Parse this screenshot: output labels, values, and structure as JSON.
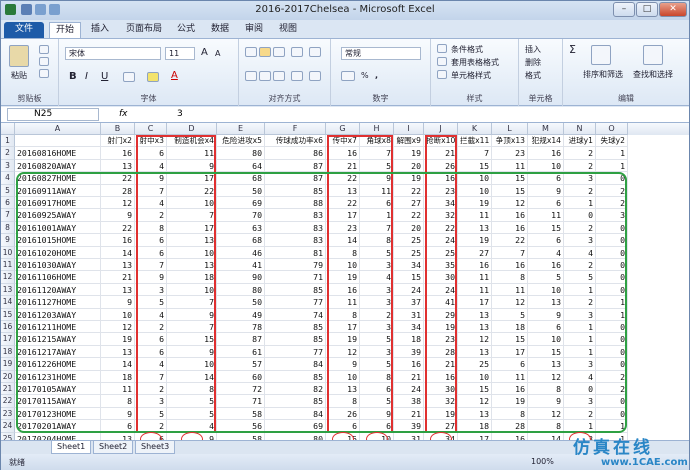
{
  "window": {
    "title": "2016-2017Chelsea - Microsoft Excel",
    "min": "–",
    "max": "□",
    "close": "✕"
  },
  "tabs": [
    "文件",
    "开始",
    "插入",
    "页面布局",
    "公式",
    "数据",
    "审阅",
    "视图"
  ],
  "ribbon": {
    "clipboard": {
      "paste": "粘贴",
      "label": "剪贴板"
    },
    "font": {
      "name": "宋体",
      "size": "11",
      "bold": "B",
      "italic": "I",
      "underline": "U",
      "grow": "A",
      "shrink": "A",
      "color_glyph": "A",
      "label": "字体"
    },
    "align": {
      "label": "对齐方式"
    },
    "number": {
      "format": "常规",
      "percent": "%",
      "comma": ",",
      "label": "数字"
    },
    "styles": {
      "cond": "条件格式",
      "table": "套用表格格式",
      "cell": "单元格样式",
      "label": "样式"
    },
    "cells": {
      "insert": "插入",
      "delete": "删除",
      "format": "格式",
      "label": "单元格"
    },
    "editing": {
      "sum": "Σ",
      "sort": "排序和筛选",
      "find": "查找和选择",
      "label": "编辑"
    }
  },
  "formula_bar": {
    "name_box": "N25",
    "fx": "fx",
    "value": "3"
  },
  "columns": [
    "A",
    "B",
    "C",
    "D",
    "E",
    "F",
    "G",
    "H",
    "I",
    "J",
    "K",
    "L",
    "M",
    "N",
    "O"
  ],
  "header_row": [
    "",
    "射门x2",
    "射中x3",
    "制造机会x4",
    "危险进攻x5",
    "传球成功率x6",
    "传中x7",
    "角球x8",
    "解围x9",
    "抢断x10",
    "拦截x11",
    "争顶x13",
    "犯规x14",
    "进球y1",
    "失球y2"
  ],
  "rows": [
    [
      "20160816HOME",
      "16",
      "6",
      "11",
      "80",
      "86",
      "16",
      "7",
      "19",
      "21",
      "7",
      "23",
      "16",
      "2",
      "1"
    ],
    [
      "20160820AWAY",
      "13",
      "4",
      "9",
      "64",
      "87",
      "21",
      "5",
      "20",
      "26",
      "15",
      "11",
      "10",
      "2",
      "1"
    ],
    [
      "20160827HOME",
      "22",
      "9",
      "17",
      "68",
      "87",
      "22",
      "9",
      "19",
      "16",
      "10",
      "15",
      "6",
      "3",
      "0"
    ],
    [
      "20160911AWAY",
      "28",
      "7",
      "22",
      "50",
      "85",
      "13",
      "11",
      "22",
      "23",
      "10",
      "15",
      "9",
      "2",
      "2"
    ],
    [
      "20160917HOME",
      "12",
      "4",
      "10",
      "69",
      "88",
      "22",
      "6",
      "27",
      "34",
      "19",
      "12",
      "6",
      "1",
      "2"
    ],
    [
      "20160925AWAY",
      "9",
      "2",
      "7",
      "70",
      "83",
      "17",
      "1",
      "22",
      "32",
      "11",
      "16",
      "11",
      "0",
      "3"
    ],
    [
      "20161001AWAY",
      "22",
      "8",
      "17",
      "63",
      "83",
      "23",
      "7",
      "20",
      "22",
      "13",
      "16",
      "15",
      "2",
      "0"
    ],
    [
      "20161015HOME",
      "16",
      "6",
      "13",
      "68",
      "83",
      "14",
      "8",
      "25",
      "24",
      "19",
      "22",
      "6",
      "3",
      "0"
    ],
    [
      "20161020HOME",
      "14",
      "6",
      "10",
      "46",
      "81",
      "8",
      "5",
      "25",
      "25",
      "27",
      "7",
      "4",
      "4",
      "0"
    ],
    [
      "20161030AWAY",
      "13",
      "7",
      "13",
      "41",
      "79",
      "10",
      "3",
      "34",
      "35",
      "16",
      "16",
      "16",
      "2",
      "0"
    ],
    [
      "20161106HOME",
      "21",
      "9",
      "18",
      "90",
      "71",
      "19",
      "4",
      "15",
      "30",
      "11",
      "8",
      "5",
      "5",
      "0"
    ],
    [
      "20161120AWAY",
      "13",
      "3",
      "10",
      "80",
      "85",
      "16",
      "3",
      "24",
      "24",
      "11",
      "11",
      "10",
      "1",
      "0"
    ],
    [
      "20161127HOME",
      "9",
      "5",
      "7",
      "50",
      "77",
      "11",
      "3",
      "37",
      "41",
      "17",
      "12",
      "13",
      "2",
      "1"
    ],
    [
      "20161203AWAY",
      "10",
      "4",
      "9",
      "49",
      "74",
      "8",
      "2",
      "31",
      "29",
      "13",
      "5",
      "9",
      "3",
      "1"
    ],
    [
      "20161211HOME",
      "12",
      "2",
      "7",
      "78",
      "85",
      "17",
      "3",
      "34",
      "19",
      "13",
      "18",
      "6",
      "1",
      "0"
    ],
    [
      "20161215AWAY",
      "19",
      "6",
      "15",
      "87",
      "85",
      "19",
      "5",
      "18",
      "23",
      "12",
      "15",
      "10",
      "1",
      "0"
    ],
    [
      "20161217AWAY",
      "13",
      "6",
      "9",
      "61",
      "77",
      "12",
      "3",
      "39",
      "28",
      "13",
      "17",
      "15",
      "1",
      "0"
    ],
    [
      "20161226HOME",
      "14",
      "4",
      "10",
      "57",
      "84",
      "9",
      "5",
      "16",
      "21",
      "25",
      "6",
      "13",
      "3",
      "0"
    ],
    [
      "20161231HOME",
      "18",
      "7",
      "14",
      "60",
      "85",
      "10",
      "8",
      "21",
      "16",
      "10",
      "11",
      "12",
      "4",
      "2"
    ],
    [
      "20170105AWAY",
      "11",
      "2",
      "8",
      "72",
      "82",
      "13",
      "6",
      "24",
      "30",
      "15",
      "16",
      "8",
      "0",
      "2"
    ],
    [
      "20170115AWAY",
      "8",
      "3",
      "5",
      "71",
      "85",
      "8",
      "5",
      "38",
      "32",
      "12",
      "19",
      "9",
      "3",
      "0"
    ],
    [
      "20170123HOME",
      "9",
      "5",
      "5",
      "58",
      "84",
      "26",
      "9",
      "21",
      "19",
      "13",
      "8",
      "12",
      "2",
      "0"
    ],
    [
      "20170201AWAY",
      "6",
      "2",
      "4",
      "56",
      "69",
      "6",
      "6",
      "39",
      "27",
      "18",
      "28",
      "8",
      "1",
      "1"
    ],
    [
      "20170204HOME",
      "13",
      "6",
      "9",
      "58",
      "80",
      "15",
      "10",
      "31",
      "34",
      "17",
      "16",
      "14",
      "3",
      "1"
    ]
  ],
  "sheets": [
    "Sheet1",
    "Sheet2",
    "Sheet3"
  ],
  "status": {
    "ready": "就绪",
    "zoom": "100%"
  },
  "watermark": {
    "line1": "仿真在线",
    "line2": "www.1CAE.com"
  }
}
